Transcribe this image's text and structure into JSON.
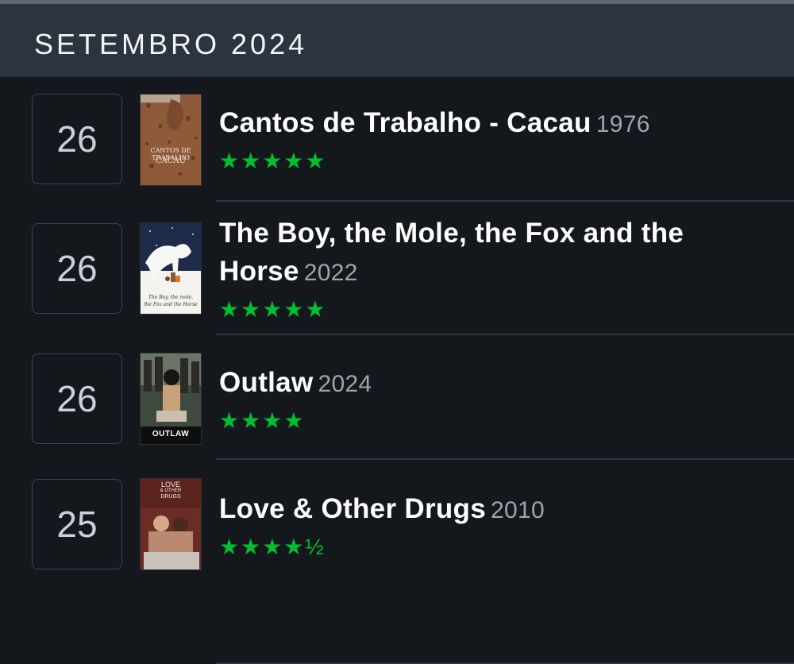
{
  "month": "SETEMBRO 2024",
  "entries": [
    {
      "day": "26",
      "title": "Cantos de Trabalho - Cacau",
      "year": "1976",
      "stars": "★★★★★",
      "rating": 5,
      "poster_text": [
        "CANTOS DE TRABALHO",
        "CACAU"
      ]
    },
    {
      "day": "26",
      "title": "The Boy, the Mole, the Fox and the Horse",
      "year": "2022",
      "stars": "★★★★★",
      "rating": 5,
      "poster_text": [
        "The Boy, the mole,",
        "the Fox and the Horse"
      ]
    },
    {
      "day": "26",
      "title": "Outlaw",
      "year": "2024",
      "stars": "★★★★",
      "rating": 4,
      "poster_text": [
        "OUTLAW"
      ]
    },
    {
      "day": "25",
      "title": "Love & Other Drugs",
      "year": "2010",
      "stars": "★★★★½",
      "rating": 4.5,
      "poster_text": [
        "LOVE",
        "& OTHER",
        "DRUGS"
      ]
    }
  ]
}
